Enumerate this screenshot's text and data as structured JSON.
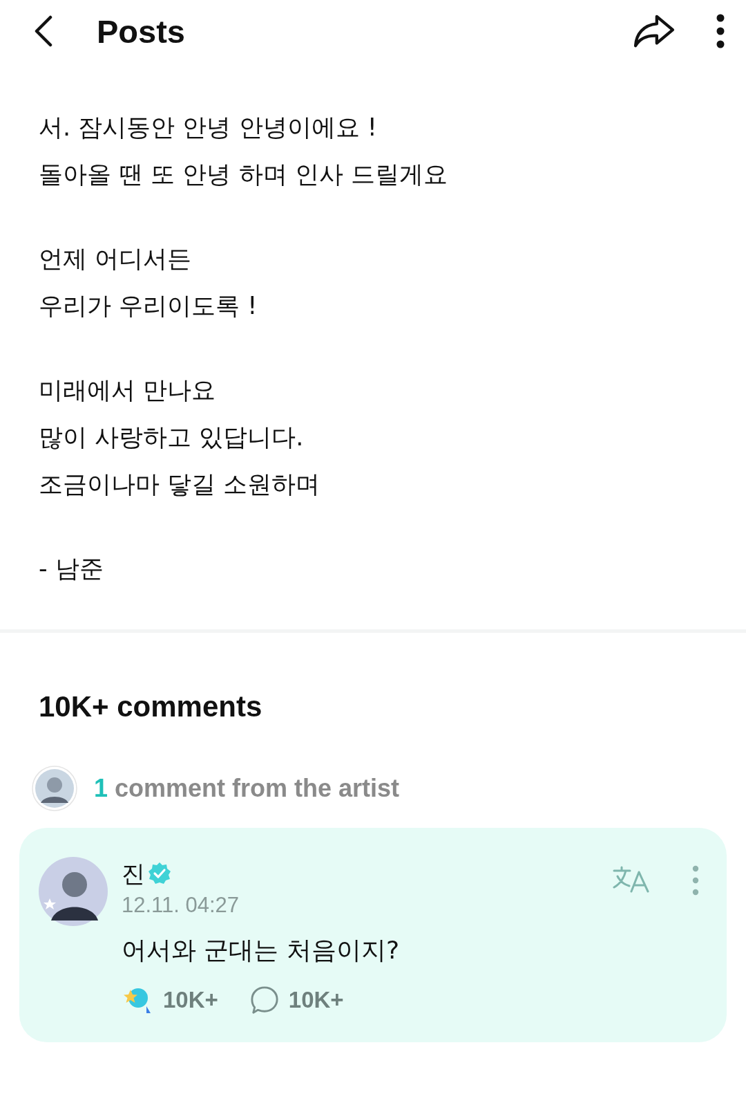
{
  "header": {
    "title": "Posts"
  },
  "post": {
    "paragraphs": [
      [
        "서. 잠시동안 안녕 안녕이에요 !",
        "돌아올 땐 또 안녕 하며 인사 드릴게요"
      ],
      [
        "언제 어디서든",
        "우리가 우리이도록 !"
      ],
      [
        "미래에서 만나요",
        "많이 사랑하고 있답니다.",
        "조금이나마 닿길 소원하며"
      ],
      [
        "- 남준"
      ]
    ]
  },
  "comments": {
    "title": "10K+ comments",
    "artist_banner": {
      "count": "1",
      "text": "comment from the artist"
    },
    "artist_comment": {
      "author": "진",
      "verified": true,
      "date": "12.11. 04:27",
      "text": "어서와 군대는 처음이지?",
      "reactions": "10K+",
      "replies": "10K+"
    }
  }
}
